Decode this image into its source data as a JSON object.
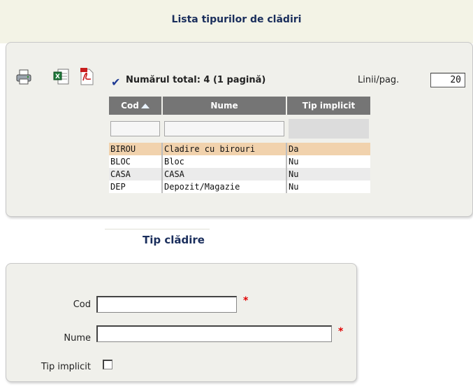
{
  "header": {
    "title": "Lista tipurilor de clădiri"
  },
  "toolbar": {
    "icons": [
      "printer-icon",
      "excel-icon",
      "pdf-icon",
      "checkmark-icon"
    ],
    "total_text": "Numărul total: 4 (1 pagină)",
    "rows_per_page_label": "Linii/pag.",
    "rows_per_page_value": "20"
  },
  "table": {
    "columns": [
      "Cod",
      "Nume",
      "Tip implicit"
    ],
    "sort": {
      "column": "Cod",
      "direction": "ascending"
    },
    "rows": [
      {
        "cod": "BIROU",
        "nume": "Cladire cu birouri",
        "tip": "Da",
        "selected": true
      },
      {
        "cod": "BLOC",
        "nume": "Bloc",
        "tip": "Nu"
      },
      {
        "cod": "CASA",
        "nume": "CASA",
        "tip": "Nu"
      },
      {
        "cod": "DEP",
        "nume": "Depozit/Magazie",
        "tip": "Nu"
      }
    ]
  },
  "form": {
    "title": "Tip clădire",
    "fields": [
      {
        "label": "Cod",
        "value": "",
        "required": true
      },
      {
        "label": "Nume",
        "value": "",
        "required": true
      },
      {
        "label": "Tip implicit",
        "checked": false
      }
    ],
    "required_marker": "*"
  },
  "colors": {
    "title": "#1a2e5c",
    "header_bg": "#757575",
    "selected_row": "#f1d2ad",
    "required": "#e00000"
  }
}
